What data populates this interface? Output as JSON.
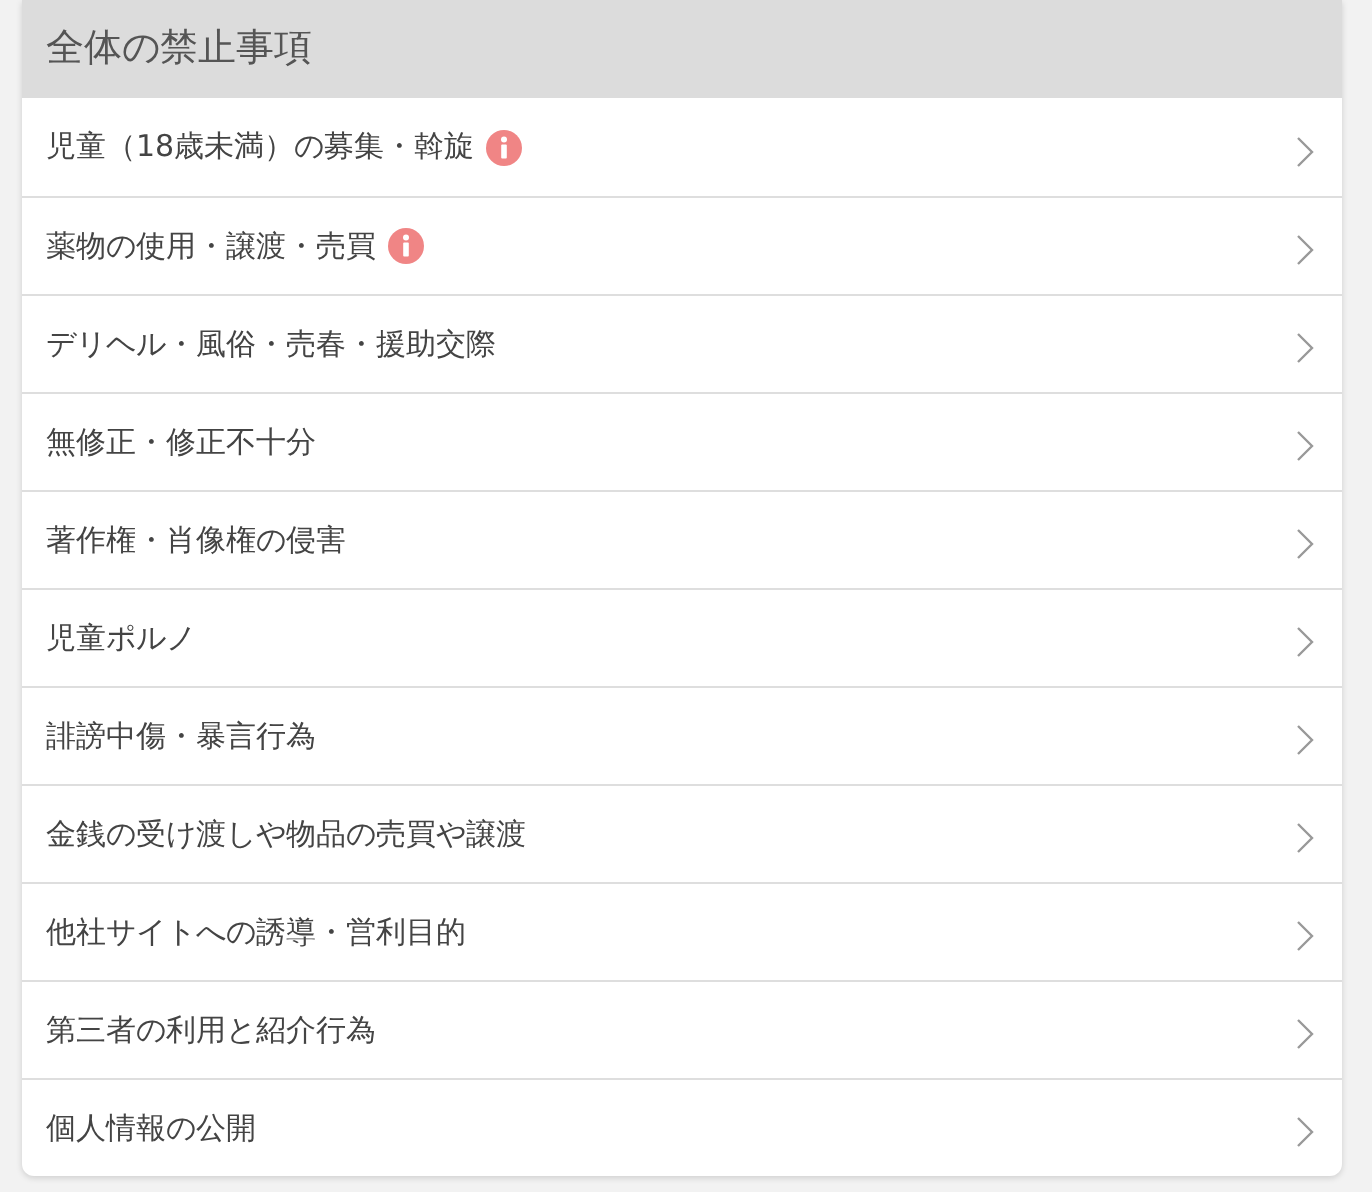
{
  "section": {
    "title": "全体の禁止事項",
    "items": [
      {
        "label": "児童（18歳未満）の募集・斡旋",
        "info": true
      },
      {
        "label": "薬物の使用・譲渡・売買",
        "info": true
      },
      {
        "label": "デリヘル・風俗・売春・援助交際",
        "info": false
      },
      {
        "label": "無修正・修正不十分",
        "info": false
      },
      {
        "label": "著作権・肖像権の侵害",
        "info": false
      },
      {
        "label": "児童ポルノ",
        "info": false
      },
      {
        "label": "誹謗中傷・暴言行為",
        "info": false
      },
      {
        "label": "金銭の受け渡しや物品の売買や譲渡",
        "info": false
      },
      {
        "label": "他社サイトへの誘導・営利目的",
        "info": false
      },
      {
        "label": "第三者の利用と紹介行為",
        "info": false
      },
      {
        "label": "個人情報の公開",
        "info": false
      }
    ]
  }
}
